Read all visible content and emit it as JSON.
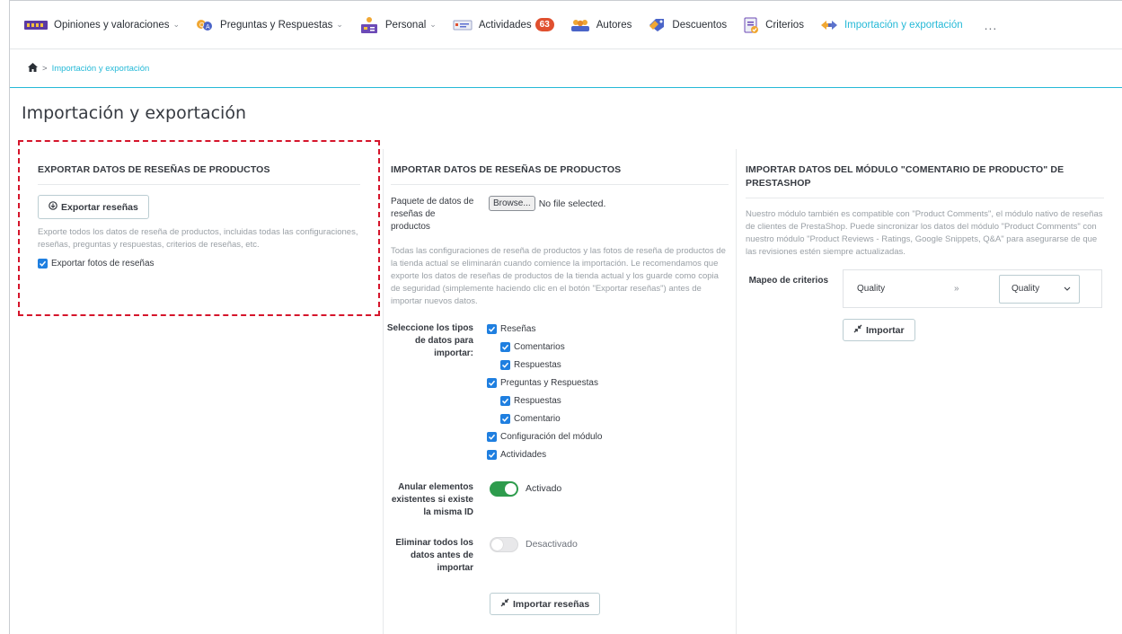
{
  "nav": {
    "items": [
      {
        "label": "Opiniones y valoraciones",
        "icon": "rating-bars-icon",
        "dropdown": true
      },
      {
        "label": "Preguntas y Respuestas",
        "icon": "qa-bubbles-icon",
        "dropdown": true
      },
      {
        "label": "Personal",
        "icon": "staff-icon",
        "dropdown": true
      },
      {
        "label": "Actividades",
        "icon": "activities-icon",
        "badge": "63"
      },
      {
        "label": "Autores",
        "icon": "authors-icon"
      },
      {
        "label": "Descuentos",
        "icon": "discount-tag-icon"
      },
      {
        "label": "Criterios",
        "icon": "criteria-clipboard-icon"
      },
      {
        "label": "Importación y exportación",
        "icon": "import-export-icon",
        "active": true
      }
    ],
    "more": "..."
  },
  "breadcrumb": {
    "home_icon": "home-icon",
    "separator": ">",
    "current": "Importación y exportación"
  },
  "page_title": "Importación y exportación",
  "export": {
    "heading": "EXPORTAR DATOS DE RESEÑAS DE PRODUCTOS",
    "button_label": "Exportar reseñas",
    "help": "Exporte todos los datos de reseña de productos, incluidas todas las configuraciones, reseñas, preguntas y respuestas, criterios de reseñas, etc.",
    "photos_label": "Exportar fotos de reseñas"
  },
  "import": {
    "heading": "IMPORTAR DATOS DE RESEÑAS DE PRODUCTOS",
    "file_label": "Paquete de datos de reseñas de productos",
    "browse_label": "Browse...",
    "file_status": "No file selected.",
    "warning": "Todas las configuraciones de reseña de productos y las fotos de reseña de productos de la tienda actual se eliminarán cuando comience la importación. Le recomendamos que exporte los datos de reseñas de productos de la tienda actual y los guarde como copia de seguridad (simplemente haciendo clic en el botón \"Exportar reseñas\") antes de importar nuevos datos.",
    "types_label": "Seleccione los tipos de datos para importar:",
    "types": [
      {
        "label": "Reseñas",
        "level": 0
      },
      {
        "label": "Comentarios",
        "level": 1
      },
      {
        "label": "Respuestas",
        "level": 1
      },
      {
        "label": "Preguntas y Respuestas",
        "level": 0
      },
      {
        "label": "Respuestas",
        "level": 1
      },
      {
        "label": "Comentario",
        "level": 1
      },
      {
        "label": "Configuración del módulo",
        "level": 0
      },
      {
        "label": "Actividades",
        "level": 0
      }
    ],
    "override_label": "Anular elementos existentes si existe la misma ID",
    "override_state": "Activado",
    "delete_label": "Eliminar todos los datos antes de importar",
    "delete_state": "Desactivado",
    "button_label": "Importar reseñas"
  },
  "prestashop": {
    "heading": "IMPORTAR DATOS DEL MÓDULO \"COMENTARIO DE PRODUCTO\" DE PRESTASHOP",
    "help": "Nuestro módulo también es compatible con \"Product Comments\", el módulo nativo de reseñas de clientes de PrestaShop. Puede sincronizar los datos del módulo \"Product Comments\" con nuestro módulo \"Product Reviews - Ratings, Google Snippets, Q&A\" para asegurarse de que las revisiones estén siempre actualizadas.",
    "mapping_label": "Mapeo de criterios",
    "source_criterion": "Quality",
    "arrow": "»",
    "target_criterion": "Quality",
    "button_label": "Importar"
  },
  "colors": {
    "accent": "#25b9d7",
    "badge": "#e0502f",
    "checkbox": "#1f7fe0",
    "switch_on": "#2e9c4d",
    "highlight_dashed": "#d5152b"
  }
}
